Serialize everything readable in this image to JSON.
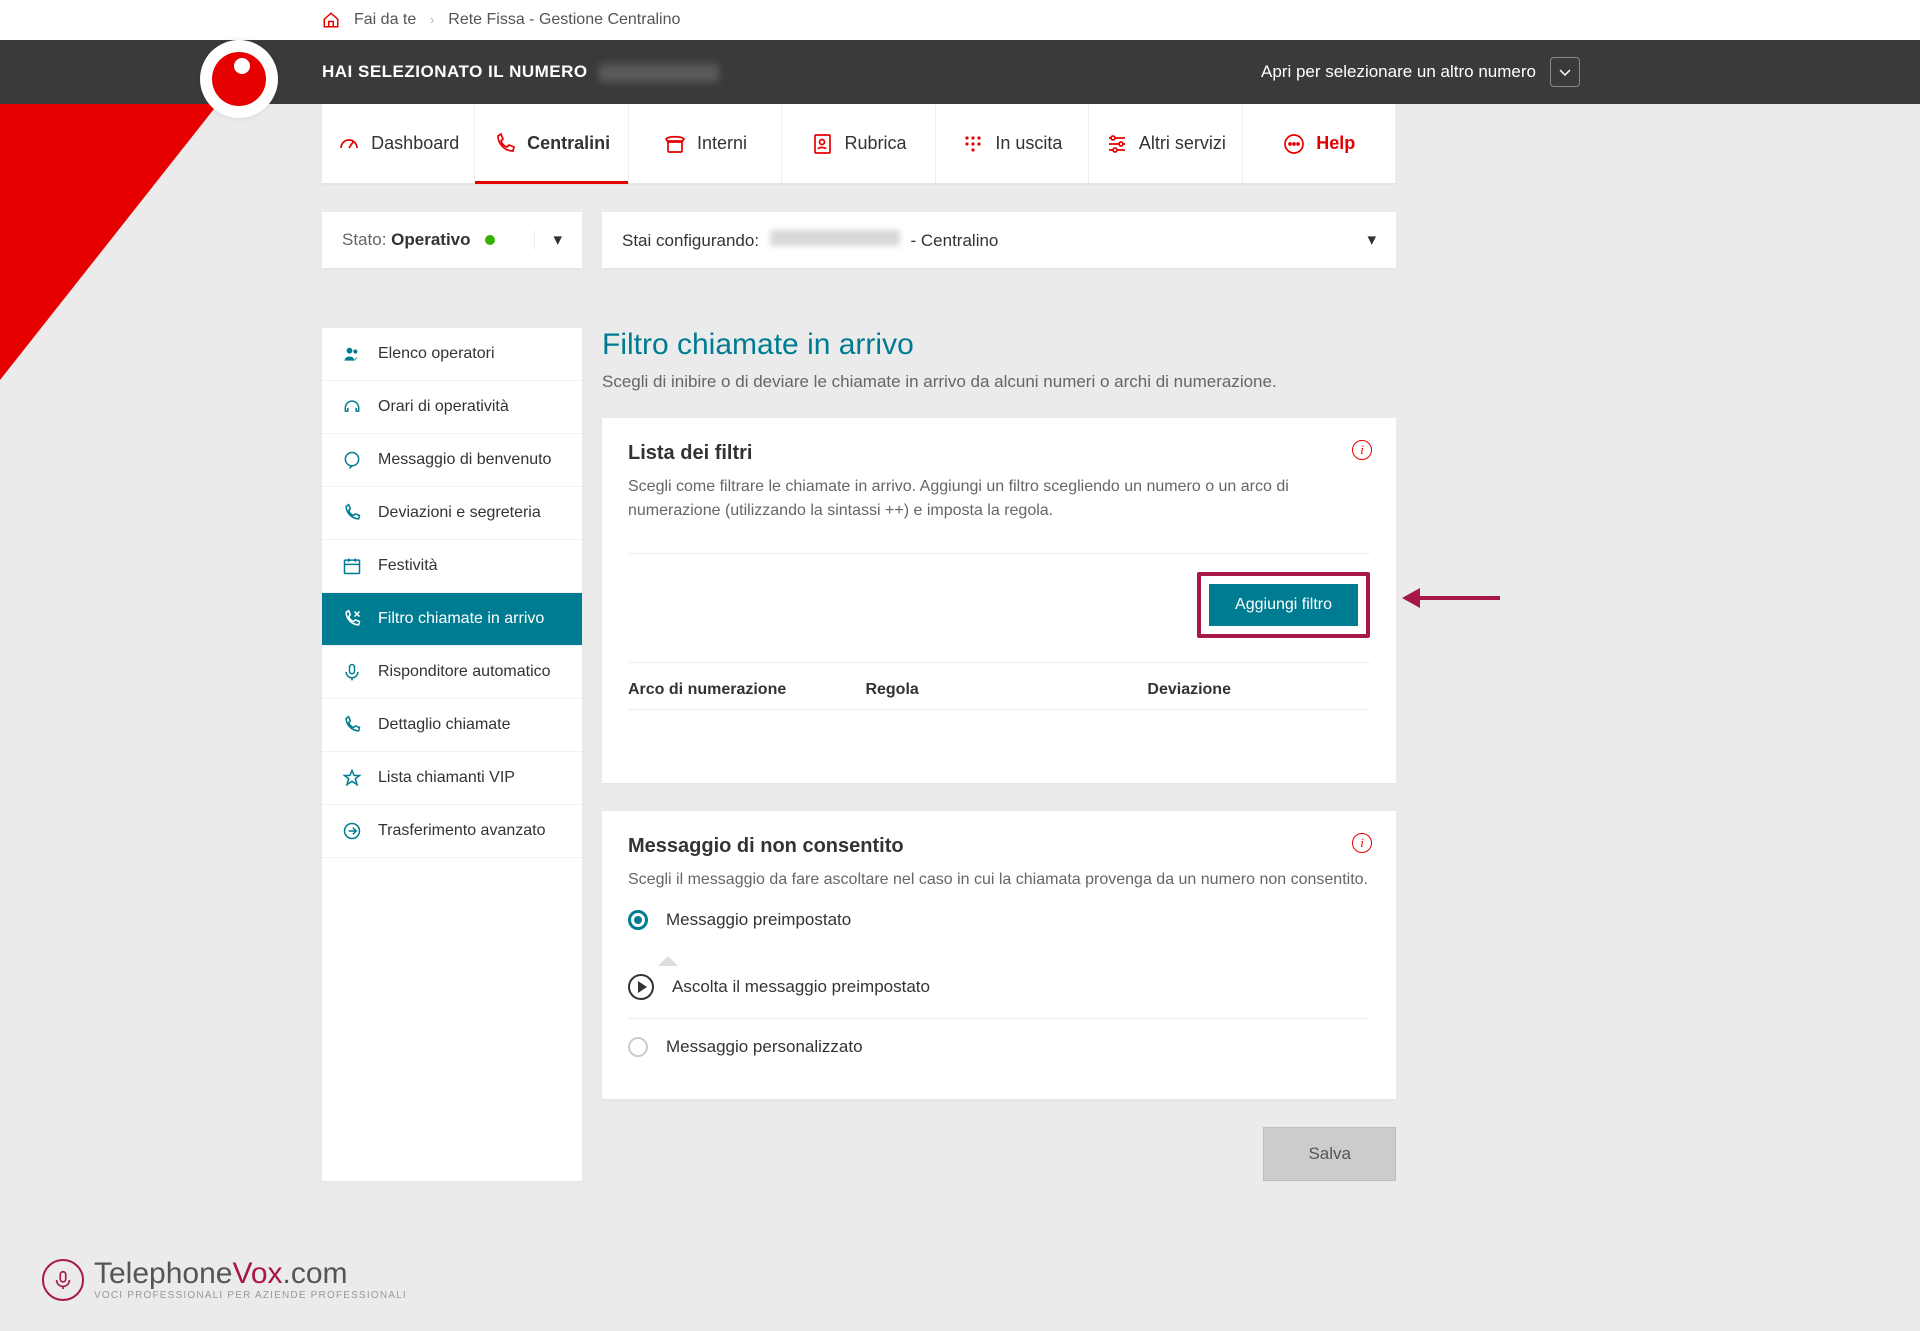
{
  "breadcrumb": {
    "home_label": "Fai da te",
    "current": "Rete Fissa - Gestione Centralino"
  },
  "header": {
    "selected_prefix": "HAI SELEZIONATO IL NUMERO",
    "other_number": "Apri per selezionare un altro numero"
  },
  "tabs": {
    "dashboard": "Dashboard",
    "centralini": "Centralini",
    "interni": "Interni",
    "rubrica": "Rubrica",
    "in_uscita": "In uscita",
    "altri_servizi": "Altri servizi",
    "help": "Help"
  },
  "status": {
    "label": "Stato:",
    "value": "Operativo",
    "config_prefix": "Stai configurando:",
    "config_suffix": "- Centralino"
  },
  "sidebar": {
    "items": [
      "Elenco operatori",
      "Orari di operatività",
      "Messaggio di benvenuto",
      "Deviazioni e segreteria",
      "Festività",
      "Filtro chiamate in arrivo",
      "Risponditore automatico",
      "Dettaglio chiamate",
      "Lista chiamanti VIP",
      "Trasferimento avanzato"
    ],
    "active_index": 5
  },
  "main": {
    "title": "Filtro chiamate in arrivo",
    "subtitle": "Scegli di inibire o di deviare le chiamate in arrivo da alcuni numeri o archi di numerazione.",
    "filters_card": {
      "heading": "Lista dei filtri",
      "desc": "Scegli come filtrare le chiamate in arrivo. Aggiungi un filtro scegliendo un numero o un arco di numerazione (utilizzando la sintassi ++) e imposta la regola.",
      "add_button": "Aggiungi filtro",
      "columns": {
        "arco": "Arco di numerazione",
        "regola": "Regola",
        "deviazione": "Deviazione"
      }
    },
    "message_card": {
      "heading": "Messaggio di non consentito",
      "desc": "Scegli il messaggio da fare ascoltare nel caso in cui la chiamata provenga da un numero non consentito.",
      "opt_preset": "Messaggio preimpostato",
      "opt_listen": "Ascolta il messaggio preimpostato",
      "opt_custom": "Messaggio personalizzato"
    },
    "save": "Salva"
  },
  "watermark": {
    "brand_a": "Telephone",
    "brand_b": "Vox",
    "brand_c": ".com",
    "tag": "VOCI PROFESSIONALI PER AZIENDE PROFESSIONALI"
  }
}
